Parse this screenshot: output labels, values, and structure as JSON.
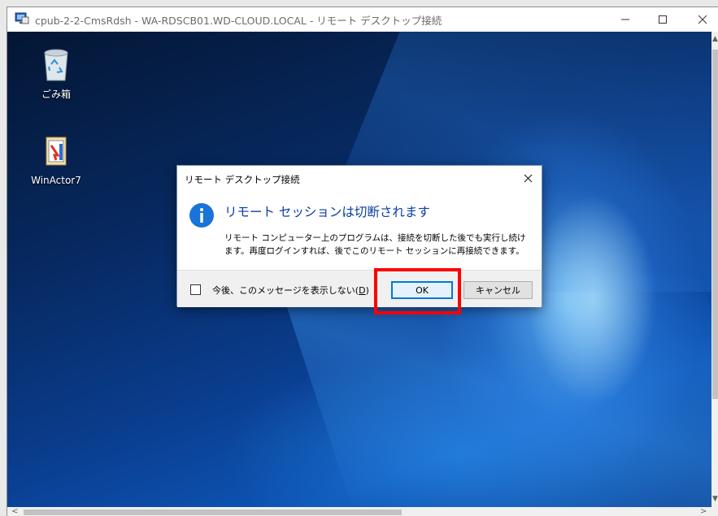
{
  "window": {
    "title": "cpub-2-2-CmsRdsh - WA-RDSCB01.WD-CLOUD.LOCAL - リモート デスクトップ接続",
    "minimize_icon": "minimize-icon",
    "maximize_icon": "maximize-icon",
    "close_icon": "close-icon"
  },
  "desktop": {
    "icons": [
      {
        "label": "ごみ箱",
        "icon": "recycle-bin-icon"
      },
      {
        "label": "WinActor7",
        "icon": "winactor-icon"
      }
    ]
  },
  "dialog": {
    "title": "リモート デスクトップ接続",
    "heading": "リモート セッションは切断されます",
    "message_line1": "リモート コンピューター上のプログラムは、接続を切断した後でも実行し続け",
    "message_line2": "ます。再度ログインすれば、後でこのリモート セッションに再接続できます。",
    "checkbox_label": "今後、このメッセージを表示しない(",
    "checkbox_accel": "D",
    "checkbox_close": ")",
    "checkbox_checked": false,
    "ok_label": "OK",
    "cancel_label": "キャンセル"
  },
  "colors": {
    "heading": "#0a3ca3",
    "highlight": "#ff0000",
    "info_icon": "#1a73d9"
  }
}
